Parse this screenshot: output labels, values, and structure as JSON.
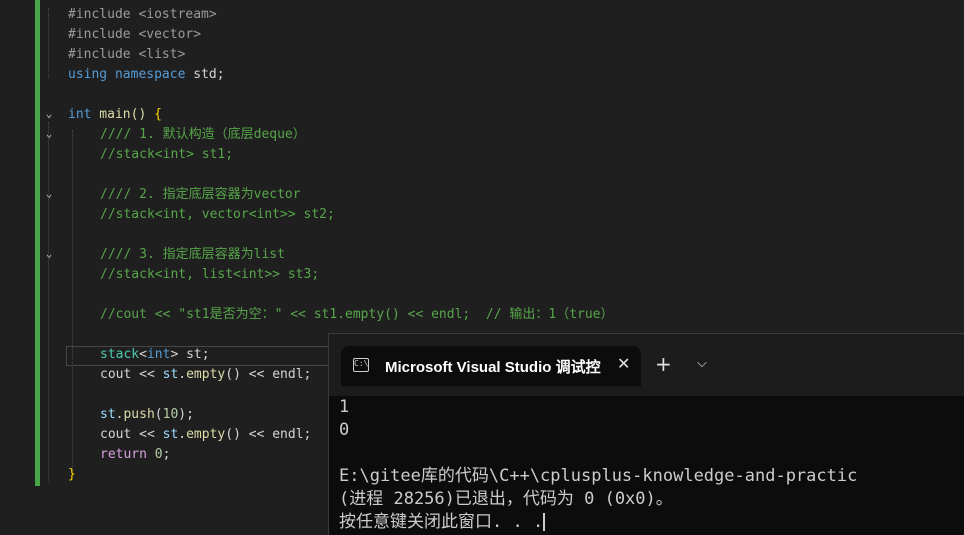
{
  "editor": {
    "lines": [
      {
        "key": "inc_iostream",
        "text": "#include <iostream>"
      },
      {
        "key": "inc_vector",
        "text": "#include <vector>"
      },
      {
        "key": "inc_list",
        "text": "#include <list>"
      },
      {
        "key": "using_kw",
        "text": "using"
      },
      {
        "key": "namespace_kw",
        "text": "namespace"
      },
      {
        "key": "std_text",
        "text": " std;"
      }
    ],
    "main_int": "int",
    "main_sig": " main() ",
    "main_brace": "{",
    "comment1": "//// 1. 默认构造（底层deque）",
    "code1": "//stack<int> st1;",
    "comment2": "//// 2. 指定底层容器为vector",
    "code2": "//stack<int, vector<int>> st2;",
    "comment3": "//// 3. 指定底层容器为list",
    "code3": "//stack<int, list<int>> st3;",
    "comment4": "//cout << \"st1是否为空：\" << st1.empty() << endl;  // 输出：1（true）",
    "stack_decl": {
      "type": "stack",
      "lt": "<",
      "int": "int",
      "gt": ">",
      "rest": " st;"
    },
    "cout1": {
      "cout": "cout",
      "op1": " << ",
      "st": "st",
      "dot": ".",
      "empty": "empty",
      "paren": "()",
      "op2": " << ",
      "endl": "endl",
      "semi": ";"
    },
    "push": {
      "st": "st",
      "dot": ".",
      "fn": "push",
      "open": "(",
      "num": "10",
      "close": ");"
    },
    "cout2": {
      "cout": "cout",
      "op1": " << ",
      "st": "st",
      "dot": ".",
      "empty": "empty",
      "paren": "()",
      "op2": " << ",
      "endl": "endl",
      "semi": ";"
    },
    "ret": {
      "kw": "return",
      "num": " 0",
      "semi": ";"
    },
    "close_brace": "}"
  },
  "terminal": {
    "tab_title": "Microsoft Visual Studio 调试控",
    "tab_icon": "C:\\",
    "close_glyph": "✕",
    "new_tab_glyph": "+",
    "dropdown_glyph": "⌵",
    "output": [
      "1",
      "0",
      "",
      "E:\\gitee库的代码\\C++\\cplusplus-knowledge-and-practic",
      "(进程 28256)已退出，代码为 0 (0x0)。",
      "按任意键关闭此窗口. . ."
    ]
  }
}
